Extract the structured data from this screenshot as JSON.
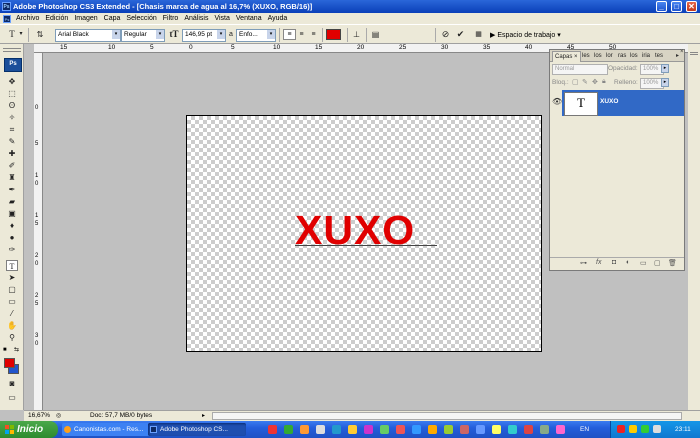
{
  "window": {
    "title": "Adobe Photoshop CS3 Extended - [Chasis marca de agua al 16,7% (XUXO, RGB/16)]",
    "app_icon_label": "Ps",
    "min": "_",
    "max": "□",
    "close": "✕"
  },
  "menu": [
    "Archivo",
    "Edición",
    "Imagen",
    "Capa",
    "Selección",
    "Filtro",
    "Análisis",
    "Vista",
    "Ventana",
    "Ayuda"
  ],
  "options": {
    "font_family": "Arial Black",
    "font_style": "Regular",
    "font_size": "146,95 pt",
    "antialias": "Enfo...",
    "aa_label": "a",
    "text_color": "#e00000",
    "workspace": "Espacio de trabajo"
  },
  "rulers": {
    "top": [
      "15",
      "10",
      "5",
      "0",
      "5",
      "10",
      "15",
      "20",
      "25",
      "30",
      "35",
      "40",
      "45",
      "50"
    ],
    "left": [
      "0",
      "5",
      "1",
      "0",
      "1",
      "5",
      "2",
      "0",
      "2",
      "5",
      "3",
      "0"
    ]
  },
  "toolbox": {
    "logo": "Ps",
    "foreground": "#e00000",
    "background": "#2255cc"
  },
  "document": {
    "text": "XUXO",
    "text_color": "#e00000"
  },
  "layers_panel": {
    "tabs": [
      "Capas ×",
      "les",
      "los",
      "lor",
      "ras",
      "los",
      "iria",
      "tes"
    ],
    "blend_mode": "Normal",
    "opacity_label": "Opacidad:",
    "opacity_value": "100%",
    "lock_label": "Bloq.:",
    "fill_label": "Relleno:",
    "fill_value": "100%",
    "layer": {
      "name": "XUXO",
      "thumb": "T"
    }
  },
  "status": {
    "zoom": "16,67%",
    "doc": "Doc: 57,7 MB/0 bytes"
  },
  "taskbar": {
    "start": "Inicio",
    "tasks": [
      "Canonistas.com - Res...",
      "Adobe Photoshop CS..."
    ],
    "lang": "EN",
    "clock": "23:11"
  }
}
